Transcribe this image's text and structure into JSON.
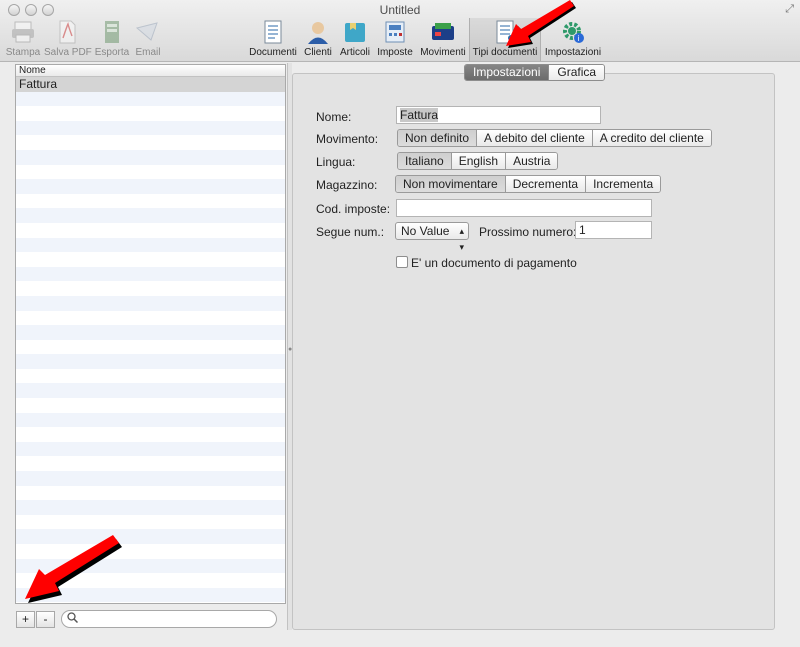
{
  "window": {
    "title": "Untitled"
  },
  "toolbar": {
    "items": [
      {
        "label": "Stampa",
        "icon": "printer-icon",
        "enabled": false
      },
      {
        "label": "Salva PDF",
        "icon": "pdf-icon",
        "enabled": false
      },
      {
        "label": "Esporta",
        "icon": "export-icon",
        "enabled": false
      },
      {
        "label": "Email",
        "icon": "email-icon",
        "enabled": false
      },
      {
        "label": "Documenti",
        "icon": "documents-icon",
        "enabled": true
      },
      {
        "label": "Clienti",
        "icon": "clients-icon",
        "enabled": true
      },
      {
        "label": "Articoli",
        "icon": "articles-icon",
        "enabled": true
      },
      {
        "label": "Imposte",
        "icon": "taxes-icon",
        "enabled": true
      },
      {
        "label": "Movimenti",
        "icon": "movements-icon",
        "enabled": true
      },
      {
        "label": "Tipi documenti",
        "icon": "document-types-icon",
        "enabled": true,
        "selected": true
      },
      {
        "label": "Impostazioni",
        "icon": "settings-gear-icon",
        "enabled": true
      }
    ]
  },
  "list": {
    "header": "Nome",
    "rows": [
      "Fattura"
    ],
    "add_label": "+",
    "remove_label": "-",
    "search_icon": "🔍"
  },
  "tabs": {
    "impostazioni": "Impostazioni",
    "grafica": "Grafica",
    "active": "Impostazioni"
  },
  "form": {
    "nome_label": "Nome:",
    "nome_value": "Fattura",
    "movimento_label": "Movimento:",
    "movimento_options": [
      "Non definito",
      "A debito del cliente",
      "A credito del cliente"
    ],
    "movimento_selected": "Non definito",
    "lingua_label": "Lingua:",
    "lingua_options": [
      "Italiano",
      "English",
      "Austria"
    ],
    "lingua_selected": "Italiano",
    "magazzino_label": "Magazzino:",
    "magazzino_options": [
      "Non movimentare",
      "Decrementa",
      "Incrementa"
    ],
    "magazzino_selected": "Non movimentare",
    "cod_imposte_label": "Cod. imposte:",
    "cod_imposte_value": "",
    "segue_label": "Segue num.:",
    "segue_value": "No Value",
    "prossimo_label": "Prossimo numero:",
    "prossimo_value": "1",
    "pagamento_label": "E' un documento di pagamento",
    "pagamento_checked": false
  },
  "colors": {
    "annotation_arrow": "#ff0000",
    "selected_row": "#d4d4d4",
    "stripe": "#f0f4fb"
  }
}
